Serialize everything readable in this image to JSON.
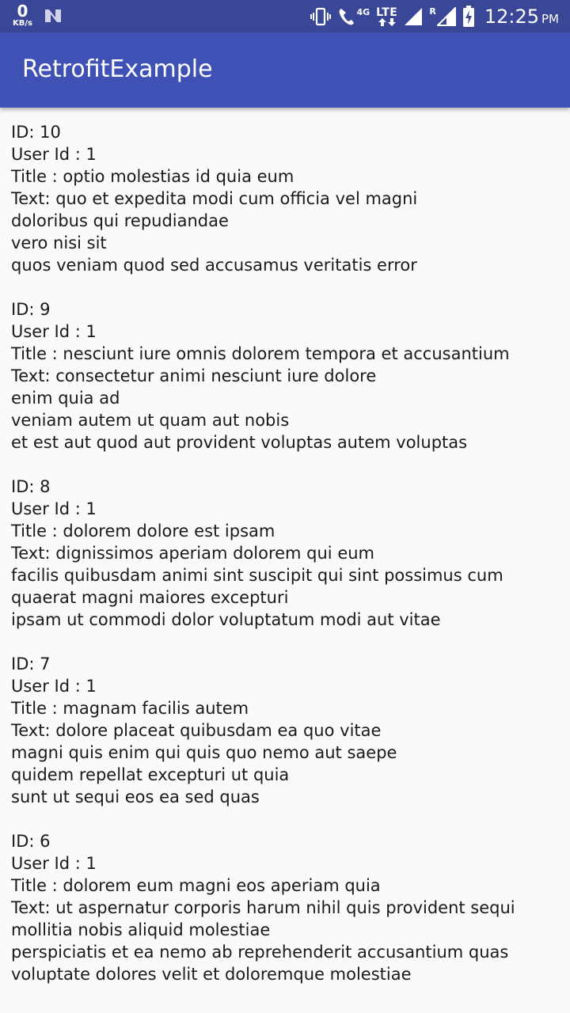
{
  "status_bar": {
    "speed_value": "0",
    "speed_unit": "KB/s",
    "network_label": "4G",
    "lte_label": "LTE",
    "roaming_label": "R",
    "time": "12:25",
    "ampm": "PM",
    "icons": [
      "n-notification-icon",
      "vibrate-icon",
      "wifi-calling-icon",
      "signal-icon",
      "signal-roaming-icon",
      "battery-charging-icon"
    ]
  },
  "app_bar": {
    "title": "RetrofitExample",
    "background_color": "#3f51b5"
  },
  "posts": [
    {
      "id": "ID: 10",
      "user": "User Id : 1",
      "title": "Title : optio molestias id quia eum",
      "text_lines": [
        "Text: quo et expedita modi cum officia vel magni",
        "doloribus qui repudiandae",
        "vero nisi sit",
        "quos veniam quod sed accusamus veritatis error"
      ]
    },
    {
      "id": "ID: 9",
      "user": "User Id : 1",
      "title": "Title : nesciunt iure omnis dolorem tempora et accusantium",
      "text_lines": [
        "Text: consectetur animi nesciunt iure dolore",
        "enim quia ad",
        "veniam autem ut quam aut nobis",
        "et est aut quod aut provident voluptas autem voluptas"
      ]
    },
    {
      "id": "ID: 8",
      "user": "User Id : 1",
      "title": "Title : dolorem dolore est ipsam",
      "text_lines": [
        "Text: dignissimos aperiam dolorem qui eum",
        "facilis quibusdam animi sint suscipit qui sint possimus cum",
        "quaerat magni maiores excepturi",
        "ipsam ut commodi dolor voluptatum modi aut vitae"
      ]
    },
    {
      "id": "ID: 7",
      "user": "User Id : 1",
      "title": "Title : magnam facilis autem",
      "text_lines": [
        "Text: dolore placeat quibusdam ea quo vitae",
        "magni quis enim qui quis quo nemo aut saepe",
        "quidem repellat excepturi ut quia",
        "sunt ut sequi eos ea sed quas"
      ]
    },
    {
      "id": "ID: 6",
      "user": "User Id : 1",
      "title": "Title : dolorem eum magni eos aperiam quia",
      "text_lines": [
        "Text: ut aspernatur corporis harum nihil quis provident sequi",
        "mollitia nobis aliquid molestiae",
        "perspiciatis et ea nemo ab reprehenderit accusantium quas",
        "voluptate dolores velit et doloremque molestiae"
      ]
    }
  ]
}
